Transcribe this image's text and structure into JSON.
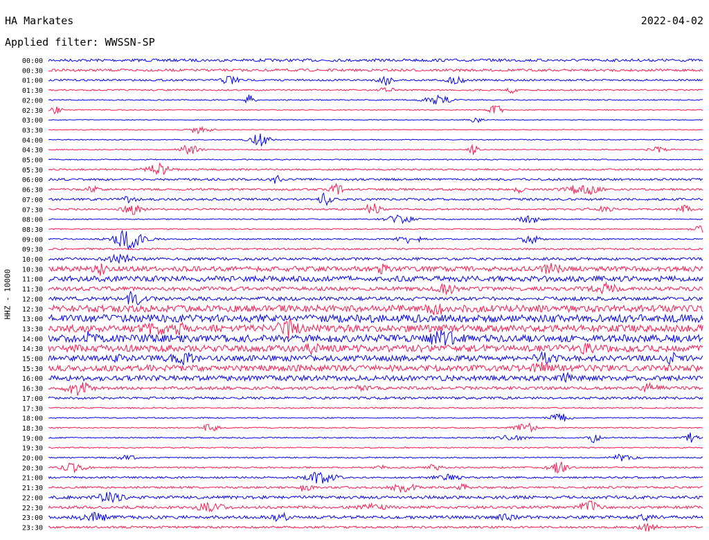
{
  "header": {
    "station": "HA Markates",
    "date": "2022-04-02",
    "filter": "Applied filter: WWSSN-SP"
  },
  "chart_data": {
    "type": "line",
    "title": "HA Markates",
    "subtitle": "Applied filter: WWSSN-SP",
    "date": "2022-04-02",
    "ylabel": "HHZ - 10000",
    "colors": {
      "line_a": "#0000ff",
      "line_b": "#ff1a4d"
    },
    "row_labels": [
      "00:00",
      "00:30",
      "01:00",
      "01:30",
      "02:00",
      "02:30",
      "03:00",
      "03:30",
      "04:00",
      "04:30",
      "05:00",
      "05:30",
      "06:00",
      "06:30",
      "07:00",
      "07:30",
      "08:00",
      "08:30",
      "09:00",
      "09:30",
      "10:00",
      "10:30",
      "11:00",
      "11:30",
      "12:00",
      "12:30",
      "13:00",
      "13:30",
      "14:00",
      "14:30",
      "15:00",
      "15:30",
      "16:00",
      "16:30",
      "17:00",
      "17:30",
      "18:00",
      "18:30",
      "19:00",
      "19:30",
      "20:00",
      "20:30",
      "21:00",
      "21:30",
      "22:00",
      "22:30",
      "23:00",
      "23:30"
    ],
    "row_color_cycle": [
      "line_a",
      "line_b"
    ],
    "activity_level": [
      0.9,
      0.8,
      0.6,
      0.5,
      0.35,
      0.3,
      0.25,
      0.25,
      0.3,
      0.3,
      0.35,
      0.55,
      0.7,
      0.7,
      0.75,
      0.6,
      0.35,
      0.35,
      0.45,
      0.6,
      0.9,
      1.6,
      1.8,
      1.3,
      1.2,
      2.2,
      2.5,
      2.3,
      2.4,
      2.3,
      1.8,
      2.0,
      1.7,
      1.0,
      0.8,
      0.45,
      0.35,
      0.4,
      0.4,
      0.4,
      0.4,
      0.5,
      0.6,
      0.7,
      1.0,
      0.9,
      1.0,
      0.7
    ]
  }
}
